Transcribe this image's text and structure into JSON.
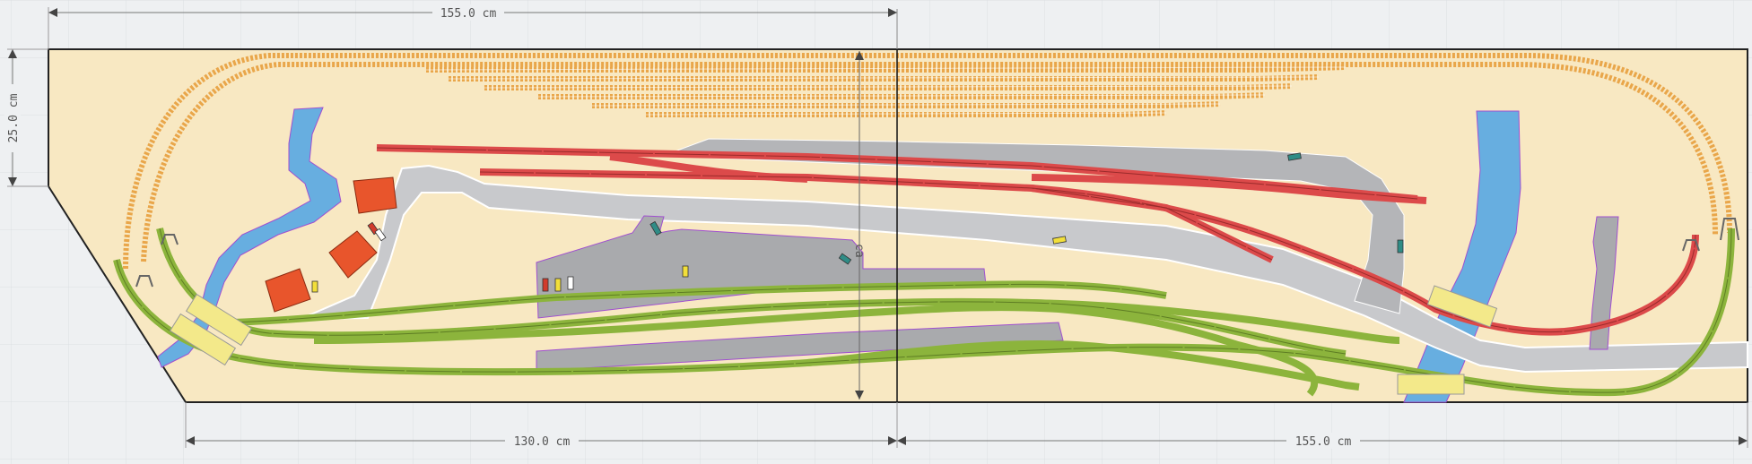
{
  "dimensions": {
    "top_width": "155.0 cm",
    "left_height": "25.0 cm",
    "bottom_left_width": "130.0 cm",
    "bottom_right_width": "155.0 cm"
  },
  "colors": {
    "baseboard": "#f8e8c2",
    "grid": "#dcdfe3",
    "water": "#67aee0",
    "road": "#c8c9cc",
    "platform": "#a9aaad",
    "track_green": "#8cb43c",
    "track_red": "#dc4a4a",
    "track_dashed": "#e9a64a",
    "building": "#e8552c",
    "bridge": "#f3e98a"
  },
  "vertical_marker_label": "ca"
}
